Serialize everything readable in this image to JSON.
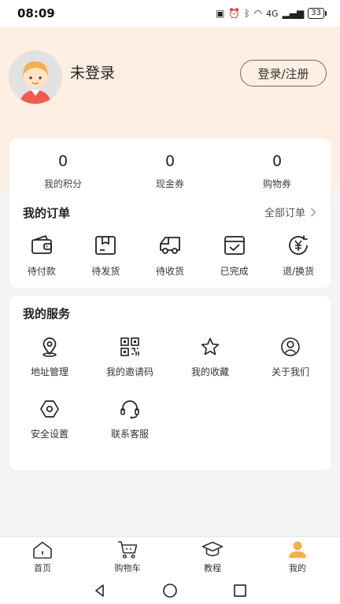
{
  "status_bar": {
    "time": "08:09",
    "signal": "4G",
    "battery": "33"
  },
  "profile": {
    "username": "未登录",
    "login_button": "登录/注册"
  },
  "stats": [
    {
      "value": "0",
      "label": "我的积分"
    },
    {
      "value": "0",
      "label": "现金券"
    },
    {
      "value": "0",
      "label": "购物券"
    }
  ],
  "orders": {
    "title": "我的订单",
    "all_link": "全部订单",
    "items": [
      {
        "label": "待付款",
        "icon": "wallet-icon"
      },
      {
        "label": "待发货",
        "icon": "package-icon"
      },
      {
        "label": "待收货",
        "icon": "truck-icon"
      },
      {
        "label": "已完成",
        "icon": "completed-icon"
      },
      {
        "label": "退/换货",
        "icon": "refund-icon"
      }
    ]
  },
  "services": {
    "title": "我的服务",
    "items": [
      {
        "label": "地址管理",
        "icon": "location-pin-icon"
      },
      {
        "label": "我的邀请码",
        "icon": "qr-code-icon"
      },
      {
        "label": "我的收藏",
        "icon": "star-icon"
      },
      {
        "label": "关于我们",
        "icon": "user-circle-icon"
      },
      {
        "label": "安全设置",
        "icon": "hexagon-settings-icon"
      },
      {
        "label": "联系客服",
        "icon": "headset-icon"
      }
    ]
  },
  "tabs": [
    {
      "label": "首页",
      "icon": "home-icon",
      "active": false
    },
    {
      "label": "购物车",
      "icon": "cart-icon",
      "active": false
    },
    {
      "label": "教程",
      "icon": "graduation-cap-icon",
      "active": false
    },
    {
      "label": "我的",
      "icon": "profile-icon",
      "active": true
    }
  ],
  "colors": {
    "header_bg": "#fdefe1",
    "accent": "#f6b04a",
    "page_bg": "#f4f4f6"
  }
}
